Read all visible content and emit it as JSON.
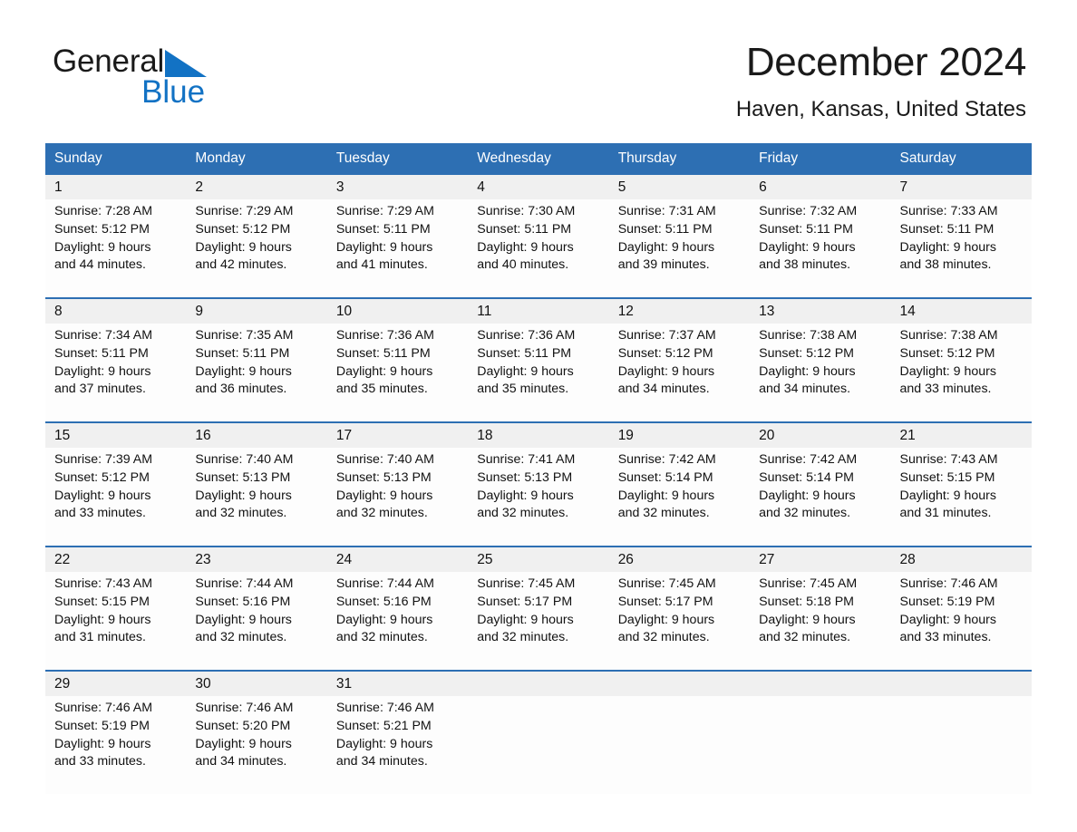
{
  "brand": {
    "name_part1": "General",
    "name_part2": "Blue",
    "flag_icon": "blue-triangle-flag-icon",
    "color_black": "#1a1a1a",
    "color_blue": "#1272c4"
  },
  "header": {
    "title": "December 2024",
    "location": "Haven, Kansas, United States"
  },
  "theme": {
    "header_blue": "#2d6fb3",
    "daynum_gray": "#f0f0f0",
    "cell_white": "#fdfdfd"
  },
  "calendar": {
    "weekday_headers": [
      "Sunday",
      "Monday",
      "Tuesday",
      "Wednesday",
      "Thursday",
      "Friday",
      "Saturday"
    ],
    "weeks": [
      [
        {
          "day": "1",
          "sunrise": "Sunrise: 7:28 AM",
          "sunset": "Sunset: 5:12 PM",
          "daylight_1": "Daylight: 9 hours",
          "daylight_2": "and 44 minutes."
        },
        {
          "day": "2",
          "sunrise": "Sunrise: 7:29 AM",
          "sunset": "Sunset: 5:12 PM",
          "daylight_1": "Daylight: 9 hours",
          "daylight_2": "and 42 minutes."
        },
        {
          "day": "3",
          "sunrise": "Sunrise: 7:29 AM",
          "sunset": "Sunset: 5:11 PM",
          "daylight_1": "Daylight: 9 hours",
          "daylight_2": "and 41 minutes."
        },
        {
          "day": "4",
          "sunrise": "Sunrise: 7:30 AM",
          "sunset": "Sunset: 5:11 PM",
          "daylight_1": "Daylight: 9 hours",
          "daylight_2": "and 40 minutes."
        },
        {
          "day": "5",
          "sunrise": "Sunrise: 7:31 AM",
          "sunset": "Sunset: 5:11 PM",
          "daylight_1": "Daylight: 9 hours",
          "daylight_2": "and 39 minutes."
        },
        {
          "day": "6",
          "sunrise": "Sunrise: 7:32 AM",
          "sunset": "Sunset: 5:11 PM",
          "daylight_1": "Daylight: 9 hours",
          "daylight_2": "and 38 minutes."
        },
        {
          "day": "7",
          "sunrise": "Sunrise: 7:33 AM",
          "sunset": "Sunset: 5:11 PM",
          "daylight_1": "Daylight: 9 hours",
          "daylight_2": "and 38 minutes."
        }
      ],
      [
        {
          "day": "8",
          "sunrise": "Sunrise: 7:34 AM",
          "sunset": "Sunset: 5:11 PM",
          "daylight_1": "Daylight: 9 hours",
          "daylight_2": "and 37 minutes."
        },
        {
          "day": "9",
          "sunrise": "Sunrise: 7:35 AM",
          "sunset": "Sunset: 5:11 PM",
          "daylight_1": "Daylight: 9 hours",
          "daylight_2": "and 36 minutes."
        },
        {
          "day": "10",
          "sunrise": "Sunrise: 7:36 AM",
          "sunset": "Sunset: 5:11 PM",
          "daylight_1": "Daylight: 9 hours",
          "daylight_2": "and 35 minutes."
        },
        {
          "day": "11",
          "sunrise": "Sunrise: 7:36 AM",
          "sunset": "Sunset: 5:11 PM",
          "daylight_1": "Daylight: 9 hours",
          "daylight_2": "and 35 minutes."
        },
        {
          "day": "12",
          "sunrise": "Sunrise: 7:37 AM",
          "sunset": "Sunset: 5:12 PM",
          "daylight_1": "Daylight: 9 hours",
          "daylight_2": "and 34 minutes."
        },
        {
          "day": "13",
          "sunrise": "Sunrise: 7:38 AM",
          "sunset": "Sunset: 5:12 PM",
          "daylight_1": "Daylight: 9 hours",
          "daylight_2": "and 34 minutes."
        },
        {
          "day": "14",
          "sunrise": "Sunrise: 7:38 AM",
          "sunset": "Sunset: 5:12 PM",
          "daylight_1": "Daylight: 9 hours",
          "daylight_2": "and 33 minutes."
        }
      ],
      [
        {
          "day": "15",
          "sunrise": "Sunrise: 7:39 AM",
          "sunset": "Sunset: 5:12 PM",
          "daylight_1": "Daylight: 9 hours",
          "daylight_2": "and 33 minutes."
        },
        {
          "day": "16",
          "sunrise": "Sunrise: 7:40 AM",
          "sunset": "Sunset: 5:13 PM",
          "daylight_1": "Daylight: 9 hours",
          "daylight_2": "and 32 minutes."
        },
        {
          "day": "17",
          "sunrise": "Sunrise: 7:40 AM",
          "sunset": "Sunset: 5:13 PM",
          "daylight_1": "Daylight: 9 hours",
          "daylight_2": "and 32 minutes."
        },
        {
          "day": "18",
          "sunrise": "Sunrise: 7:41 AM",
          "sunset": "Sunset: 5:13 PM",
          "daylight_1": "Daylight: 9 hours",
          "daylight_2": "and 32 minutes."
        },
        {
          "day": "19",
          "sunrise": "Sunrise: 7:42 AM",
          "sunset": "Sunset: 5:14 PM",
          "daylight_1": "Daylight: 9 hours",
          "daylight_2": "and 32 minutes."
        },
        {
          "day": "20",
          "sunrise": "Sunrise: 7:42 AM",
          "sunset": "Sunset: 5:14 PM",
          "daylight_1": "Daylight: 9 hours",
          "daylight_2": "and 32 minutes."
        },
        {
          "day": "21",
          "sunrise": "Sunrise: 7:43 AM",
          "sunset": "Sunset: 5:15 PM",
          "daylight_1": "Daylight: 9 hours",
          "daylight_2": "and 31 minutes."
        }
      ],
      [
        {
          "day": "22",
          "sunrise": "Sunrise: 7:43 AM",
          "sunset": "Sunset: 5:15 PM",
          "daylight_1": "Daylight: 9 hours",
          "daylight_2": "and 31 minutes."
        },
        {
          "day": "23",
          "sunrise": "Sunrise: 7:44 AM",
          "sunset": "Sunset: 5:16 PM",
          "daylight_1": "Daylight: 9 hours",
          "daylight_2": "and 32 minutes."
        },
        {
          "day": "24",
          "sunrise": "Sunrise: 7:44 AM",
          "sunset": "Sunset: 5:16 PM",
          "daylight_1": "Daylight: 9 hours",
          "daylight_2": "and 32 minutes."
        },
        {
          "day": "25",
          "sunrise": "Sunrise: 7:45 AM",
          "sunset": "Sunset: 5:17 PM",
          "daylight_1": "Daylight: 9 hours",
          "daylight_2": "and 32 minutes."
        },
        {
          "day": "26",
          "sunrise": "Sunrise: 7:45 AM",
          "sunset": "Sunset: 5:17 PM",
          "daylight_1": "Daylight: 9 hours",
          "daylight_2": "and 32 minutes."
        },
        {
          "day": "27",
          "sunrise": "Sunrise: 7:45 AM",
          "sunset": "Sunset: 5:18 PM",
          "daylight_1": "Daylight: 9 hours",
          "daylight_2": "and 32 minutes."
        },
        {
          "day": "28",
          "sunrise": "Sunrise: 7:46 AM",
          "sunset": "Sunset: 5:19 PM",
          "daylight_1": "Daylight: 9 hours",
          "daylight_2": "and 33 minutes."
        }
      ],
      [
        {
          "day": "29",
          "sunrise": "Sunrise: 7:46 AM",
          "sunset": "Sunset: 5:19 PM",
          "daylight_1": "Daylight: 9 hours",
          "daylight_2": "and 33 minutes."
        },
        {
          "day": "30",
          "sunrise": "Sunrise: 7:46 AM",
          "sunset": "Sunset: 5:20 PM",
          "daylight_1": "Daylight: 9 hours",
          "daylight_2": "and 34 minutes."
        },
        {
          "day": "31",
          "sunrise": "Sunrise: 7:46 AM",
          "sunset": "Sunset: 5:21 PM",
          "daylight_1": "Daylight: 9 hours",
          "daylight_2": "and 34 minutes."
        },
        {
          "day": "",
          "sunrise": "",
          "sunset": "",
          "daylight_1": "",
          "daylight_2": ""
        },
        {
          "day": "",
          "sunrise": "",
          "sunset": "",
          "daylight_1": "",
          "daylight_2": ""
        },
        {
          "day": "",
          "sunrise": "",
          "sunset": "",
          "daylight_1": "",
          "daylight_2": ""
        },
        {
          "day": "",
          "sunrise": "",
          "sunset": "",
          "daylight_1": "",
          "daylight_2": ""
        }
      ]
    ]
  }
}
